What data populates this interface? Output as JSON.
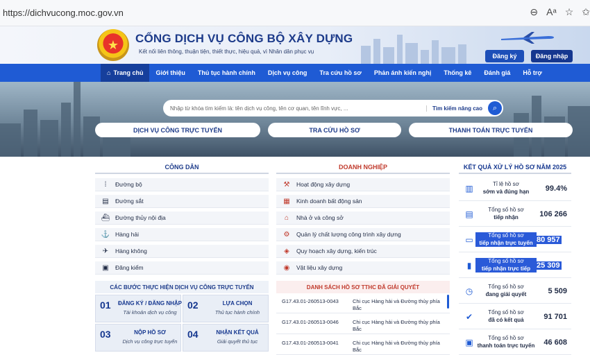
{
  "browser": {
    "url": "https://dichvucong.moc.gov.vn"
  },
  "header": {
    "title": "CỔNG DỊCH VỤ CÔNG BỘ XÂY DỰNG",
    "subtitle": "Kết nối liên thông, thuận tiện, thiết thực, hiệu quả, vì Nhân dân phục vụ",
    "register_label": "Đăng ký",
    "login_label": "Đăng nhập"
  },
  "nav": {
    "items": [
      "Trang chủ",
      "Giới thiệu",
      "Thủ tục hành chính",
      "Dịch vụ công",
      "Tra cứu hồ sơ",
      "Phản ánh kiến nghị",
      "Thống kê",
      "Đánh giá",
      "Hỗ trợ"
    ]
  },
  "search": {
    "placeholder": "Nhập từ khóa tìm kiếm là: tên dịch vụ công, tên cơ quan, tên lĩnh vực, ...",
    "advanced_label": "Tìm kiếm nâng cao"
  },
  "quick": {
    "services": "DỊCH VỤ CÔNG TRỰC TUYẾN",
    "lookup": "TRA CỨU HỒ SƠ",
    "payment": "THANH TOÁN TRỰC TUYẾN"
  },
  "citizen": {
    "title": "CÔNG DÂN",
    "items": [
      "Đường bộ",
      "Đường sắt",
      "Đường thủy nội địa",
      "Hàng hải",
      "Hàng không",
      "Đăng kiểm"
    ]
  },
  "steps": {
    "title": "CÁC BƯỚC THỰC HIỆN DỊCH VỤ CÔNG TRỰC TUYẾN",
    "items": [
      {
        "num": "01",
        "title": "ĐĂNG KÝ / ĐĂNG NHẬP",
        "sub": "Tài khoản dịch vụ công"
      },
      {
        "num": "02",
        "title": "LỰA CHỌN",
        "sub": "Thủ tục hành chính"
      },
      {
        "num": "03",
        "title": "NỘP HỒ SƠ",
        "sub": "Dịch vụ công trực tuyến"
      },
      {
        "num": "04",
        "title": "NHẬN KẾT QUẢ",
        "sub": "Giải quyết thủ tục"
      }
    ]
  },
  "business": {
    "title": "DOANH NGHIỆP",
    "items": [
      "Hoạt động xây dựng",
      "Kinh doanh bất động sản",
      "Nhà ở và công sở",
      "Quản lý chất lượng công trình xây dựng",
      "Quy hoạch xây dựng, kiến trúc",
      "Vật liệu xây dựng"
    ]
  },
  "resolved": {
    "title": "DANH SÁCH HỒ SƠ TTHC ĐÃ GIẢI QUYẾT",
    "rows": [
      {
        "code": "G17.43.01-260513-0043",
        "org": "Chi cục Hàng hải và Đường thủy phía Bắc"
      },
      {
        "code": "G17.43.01-260513-0046",
        "org": "Chi cục Hàng hải và Đường thủy phía Bắc"
      },
      {
        "code": "G17.43.01-260513-0041",
        "org": "Chi cục Hàng hải và Đường thủy phía Bắc"
      }
    ]
  },
  "stats": {
    "title": "KẾT QUẢ XỬ LÝ HỒ SƠ NĂM 2025",
    "items": [
      {
        "l1": "Tỉ lệ hồ sơ",
        "l2": "sớm và đúng hạn",
        "value": "99.4%",
        "icon": "bar-chart-icon"
      },
      {
        "l1": "Tổng số hồ sơ",
        "l2": "tiếp nhận",
        "value": "106 266",
        "icon": "document-icon"
      },
      {
        "l1": "Tổng số hồ sơ",
        "l2": "tiếp nhận trực tuyến",
        "value": "80 957",
        "icon": "online-icon"
      },
      {
        "l1": "Tổng số hồ sơ",
        "l2": "tiếp nhận trực tiếp",
        "value": "25 309",
        "icon": "direct-icon"
      },
      {
        "l1": "Tổng số hồ sơ",
        "l2": "đang giải quyết",
        "value": "5 509",
        "icon": "clock-icon"
      },
      {
        "l1": "Tổng số hồ sơ",
        "l2": "đã có kết quả",
        "value": "91 701",
        "icon": "check-icon"
      },
      {
        "l1": "Tổng số hồ sơ",
        "l2": "thanh toán trực tuyến",
        "value": "46 608",
        "icon": "payment-icon"
      }
    ]
  },
  "colors": {
    "primary": "#1f5bd4",
    "dark": "#15378f",
    "accent_red": "#c0392b"
  }
}
